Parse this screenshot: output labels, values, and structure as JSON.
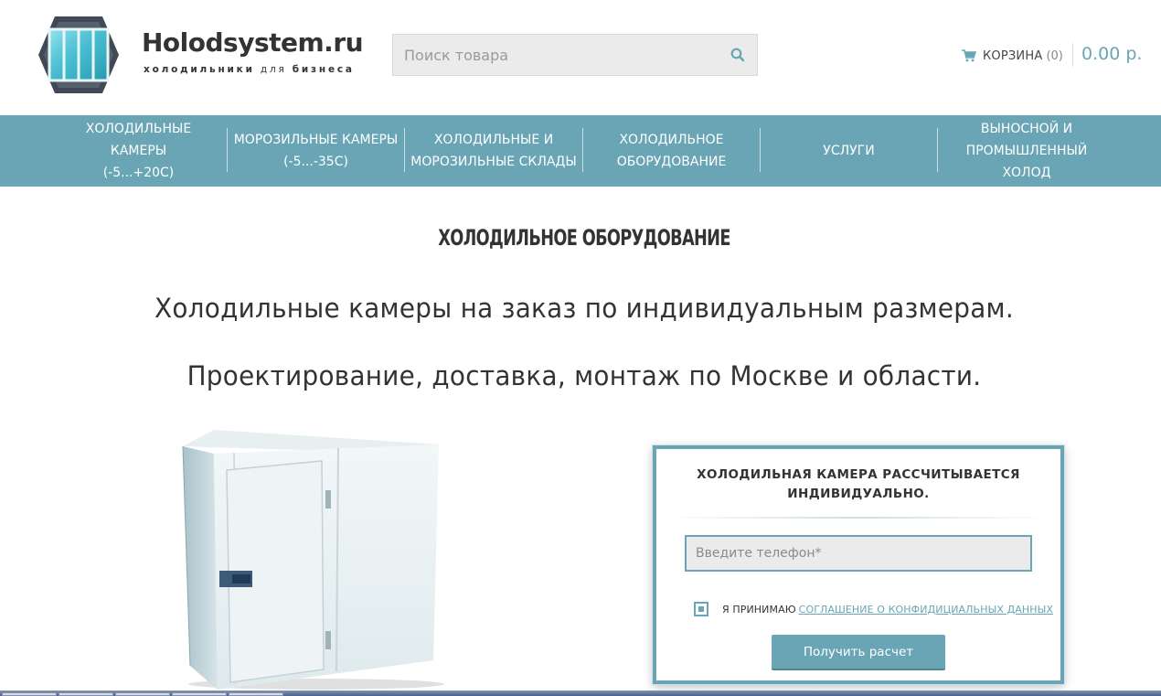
{
  "header": {
    "logo_title": "Holodsystem.ru",
    "logo_sub_1": "холодильники",
    "logo_sub_2": "для",
    "logo_sub_3": "бизнеса",
    "search_placeholder": "Поиск товара",
    "cart_label": "КОРЗИНА",
    "cart_count": "(0)",
    "cart_total": "0.00 р."
  },
  "nav": {
    "items": [
      {
        "line1": "ХОЛОДИЛЬНЫЕ КАМЕРЫ",
        "line2": "(-5...+20С)"
      },
      {
        "line1": "МОРОЗИЛЬНЫЕ КАМЕРЫ",
        "line2": "(-5...-35С)"
      },
      {
        "line1": "ХОЛОДИЛЬНЫЕ И",
        "line2": "МОРОЗИЛЬНЫЕ СКЛАДЫ"
      },
      {
        "line1": "ХОЛОДИЛЬНОЕ",
        "line2": "ОБОРУДОВАНИЕ"
      },
      {
        "line1": "УСЛУГИ",
        "line2": ""
      },
      {
        "line1": "ВЫНОСНОЙ И",
        "line2": "ПРОМЫШЛЕННЫЙ ХОЛОД"
      }
    ]
  },
  "main": {
    "title": "ХОЛОДИЛЬНОЕ ОБОРУДОВАНИЕ",
    "lead_1": "Холодильные камеры на заказ по индивидуальным размерам.",
    "lead_2": "Проектирование, доставка, монтаж по Москве и области."
  },
  "calc_form": {
    "title_1": "ХОЛОДИЛЬНАЯ КАМЕРА РАССЧИТЫВАЕТСЯ",
    "title_2": "ИНДИВИДУАЛЬНО.",
    "phone_placeholder": "Введите телефон*",
    "consent_text": "Я ПРИНИМАЮ",
    "consent_link": "СОГЛАШЕНИЕ О КОНФИДИЦИАЛЬНЫХ ДАННЫХ",
    "consent_checked": true,
    "submit_label": "Получить расчет"
  },
  "colors": {
    "accent": "#6aa5b5",
    "text": "#333333",
    "input_bg": "#ebebeb"
  }
}
